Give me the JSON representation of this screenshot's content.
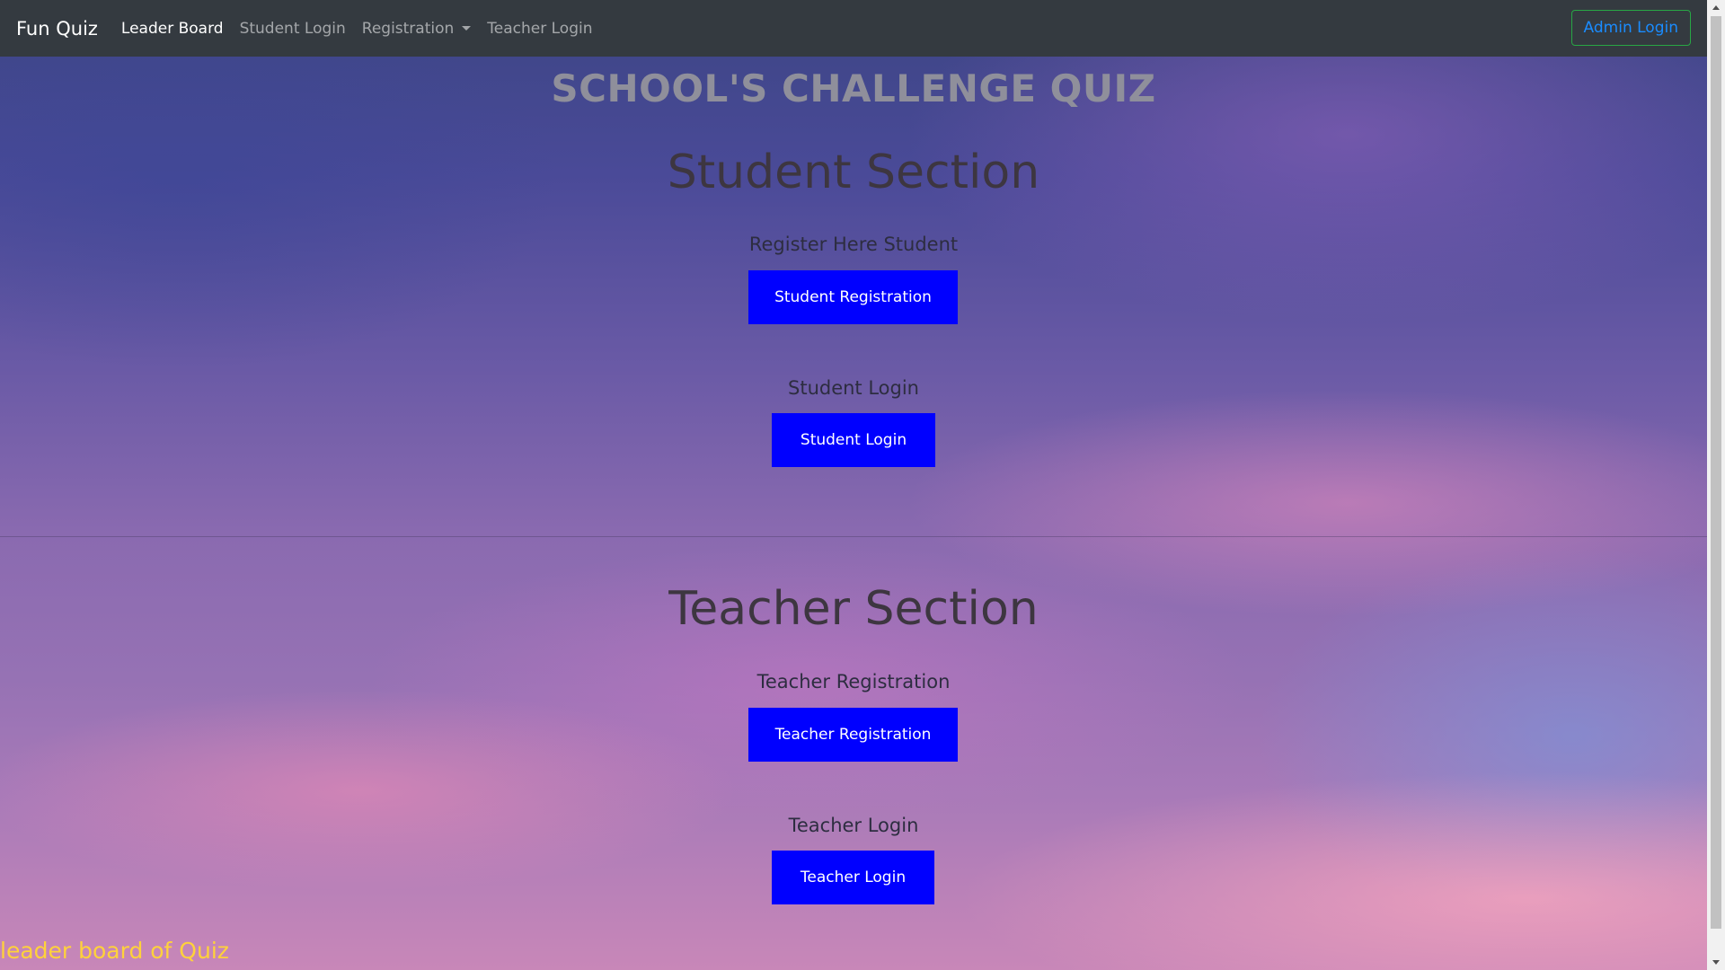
{
  "navbar": {
    "brand": "Fun Quiz",
    "links": {
      "leader_board": "Leader Board",
      "student_login": "Student Login",
      "registration": "Registration",
      "teacher_login": "Teacher Login"
    },
    "admin_login": "Admin Login"
  },
  "main": {
    "title": "SCHOOL'S CHALLENGE QUIZ",
    "student_section": {
      "heading": "Student Section",
      "register_label": "Register Here Student",
      "register_button": "Student Registration",
      "login_label": "Student Login",
      "login_button": "Student Login"
    },
    "teacher_section": {
      "heading": "Teacher Section",
      "register_label": "Teacher Registration",
      "register_button": "Teacher Registration",
      "login_label": "Teacher Login",
      "login_button": "Teacher Login"
    }
  },
  "footer": {
    "text": "leader board of Quiz"
  },
  "colors": {
    "navbar_bg": "#343a40",
    "button_blue": "#0000ff",
    "admin_border": "#28a745",
    "admin_text": "#1a8cff",
    "footer_text": "#ffd23a"
  }
}
